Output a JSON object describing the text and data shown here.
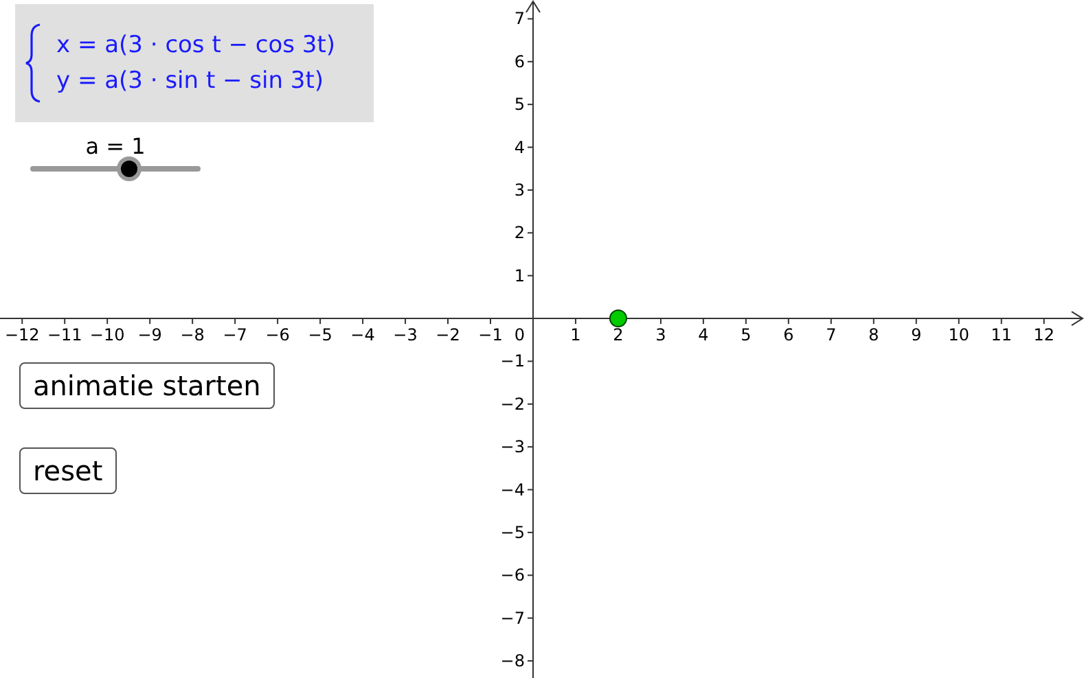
{
  "formula": {
    "lines": [
      "x = a(3 · cos t − cos 3t)",
      "y = a(3 · sin t − sin 3t)"
    ]
  },
  "slider": {
    "label": "a = 1",
    "level": 0.59
  },
  "buttons": [
    {
      "label": "animatie starten"
    },
    {
      "label": "reset"
    }
  ],
  "graph": {
    "origin_label": "0",
    "chart_data": {
      "type": "scatter",
      "x": [
        2
      ],
      "series": [
        {
          "color": "#00cc00",
          "values": [
            0
          ]
        }
      ],
      "xlim": [
        -12.52,
        12.94
      ],
      "ylim": [
        -8.4,
        7.44
      ],
      "xticks": [
        {
          "value": -12,
          "label": "−12"
        },
        {
          "value": -11,
          "label": "−11"
        },
        {
          "value": -10,
          "label": "−10"
        },
        {
          "value": -9,
          "label": "−9"
        },
        {
          "value": -8,
          "label": "−8"
        },
        {
          "value": -7,
          "label": "−7"
        },
        {
          "value": -6,
          "label": "−6"
        },
        {
          "value": -5,
          "label": "−5"
        },
        {
          "value": -4,
          "label": "−4"
        },
        {
          "value": -3,
          "label": "−3"
        },
        {
          "value": -2,
          "label": "−2"
        },
        {
          "value": -1,
          "label": "−1"
        },
        {
          "value": 1,
          "label": "1"
        },
        {
          "value": 2,
          "label": "2"
        },
        {
          "value": 3,
          "label": "3"
        },
        {
          "value": 4,
          "label": "4"
        },
        {
          "value": 5,
          "label": "5"
        },
        {
          "value": 6,
          "label": "6"
        },
        {
          "value": 7,
          "label": "7"
        },
        {
          "value": 8,
          "label": "8"
        },
        {
          "value": 9,
          "label": "9"
        },
        {
          "value": 10,
          "label": "10"
        },
        {
          "value": 11,
          "label": "11"
        },
        {
          "value": 12,
          "label": "12"
        }
      ],
      "yticks": [
        {
          "value": 7,
          "label": "7"
        },
        {
          "value": 6,
          "label": "6"
        },
        {
          "value": 5,
          "label": "5"
        },
        {
          "value": 4,
          "label": "4"
        },
        {
          "value": 3,
          "label": "3"
        },
        {
          "value": 2,
          "label": "2"
        },
        {
          "value": 1,
          "label": "1"
        },
        {
          "value": -1,
          "label": "−1"
        },
        {
          "value": -2,
          "label": "−2"
        },
        {
          "value": -3,
          "label": "−3"
        },
        {
          "value": -4,
          "label": "−4"
        },
        {
          "value": -5,
          "label": "−5"
        },
        {
          "value": -6,
          "label": "−6"
        },
        {
          "value": -7,
          "label": "−7"
        },
        {
          "value": -8,
          "label": "−8"
        }
      ]
    }
  }
}
